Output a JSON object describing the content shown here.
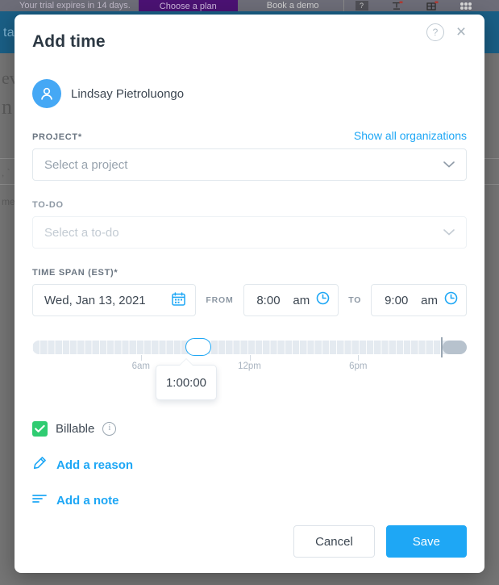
{
  "background": {
    "trial_notice": "Your trial expires in 14 days.",
    "choose_plan": "Choose a plan",
    "book_demo": "Book a demo",
    "help_badge": "?",
    "bluebar_text": "ta",
    "page_fragment_1": "ev",
    "page_fragment_2": "n",
    "page_fragment_3": ", `",
    "page_fragment_4": "me"
  },
  "modal": {
    "title": "Add time",
    "help_label": "?",
    "close_label": "×",
    "user": {
      "name": "Lindsay Pietroluongo",
      "avatar_icon": "person-icon"
    },
    "project": {
      "label": "PROJECT*",
      "link": "Show all organizations",
      "placeholder": "Select a project",
      "chevron_icon": "chevron-down-icon"
    },
    "todo": {
      "label": "TO-DO",
      "placeholder": "Select a to-do",
      "chevron_icon": "chevron-down-icon"
    },
    "timespan": {
      "label": "TIME SPAN (EST)*",
      "date": "Wed, Jan 13, 2021",
      "calendar_icon": "calendar-icon",
      "from_label": "FROM",
      "from_time": "8:00",
      "from_ampm": "am",
      "to_label": "TO",
      "to_time": "9:00",
      "to_ampm": "am",
      "clock_icon": "clock-icon"
    },
    "slider": {
      "tooltip_value": "1:00:00",
      "ticks": [
        {
          "label": "6am",
          "pos_pct": 25.0
        },
        {
          "label": "12pm",
          "pos_pct": 50.0
        },
        {
          "label": "6pm",
          "pos_pct": 75.0
        }
      ],
      "thumb_pos_pct": 34.8,
      "end_handle_pos_pct": 94.5
    },
    "billable": {
      "label": "Billable",
      "checked": true,
      "check_icon": "checkmark-icon",
      "info_icon": "info-icon"
    },
    "add_reason": {
      "label": "Add a reason",
      "icon": "pencil-icon"
    },
    "add_note": {
      "label": "Add a note",
      "icon": "lines-icon"
    },
    "footer": {
      "cancel_label": "Cancel",
      "save_label": "Save"
    }
  },
  "colors": {
    "accent_blue": "#1ea7f5",
    "avatar_blue": "#45a8f5",
    "billable_green": "#2fcc71",
    "text_dark": "#3d4752",
    "border": "#e2e8ed",
    "plan_purple": "#4b1273"
  }
}
